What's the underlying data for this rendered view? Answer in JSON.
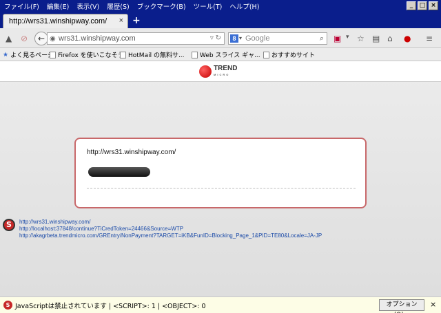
{
  "menu": [
    "ファイル(F)",
    "編集(E)",
    "表示(V)",
    "履歴(S)",
    "ブックマーク(B)",
    "ツール(T)",
    "ヘルプ(H)"
  ],
  "window_buttons": [
    "_",
    "□",
    "×"
  ],
  "tab": {
    "title": "http://wrs31.winshipway.com/",
    "close": "×",
    "new_tab": "+"
  },
  "nav": {
    "url": "wrs31.winshipway.com",
    "search_placeholder": "Google",
    "search_engine_letter": "8"
  },
  "bookmarks": [
    "よく見るページ",
    "Firefox を使いこなそう",
    "HotMail の無料サ...",
    "Web スライス ギャ...",
    "おすすめサイト"
  ],
  "brand": {
    "name": "TREND",
    "sub": "MICRO"
  },
  "card": {
    "url": "http://wrs31.winshipway.com/"
  },
  "links": [
    "http://wrs31.winshipway.com/",
    "http://localhost:37848/continue?TiCredToken=24466&Source=WTP",
    "http://akagrbeta.trendmicro.com/GREntry/NonPayment?TARGET=iKB&FunID=Blocking_Page_1&PID=TE80&Locale=JA-JP"
  ],
  "status": {
    "text": "JavaScriptは禁止されています | <SCRIPT>: 1 | <OBJECT>: 0",
    "options_label": "オプション(O)...",
    "close": "×"
  }
}
